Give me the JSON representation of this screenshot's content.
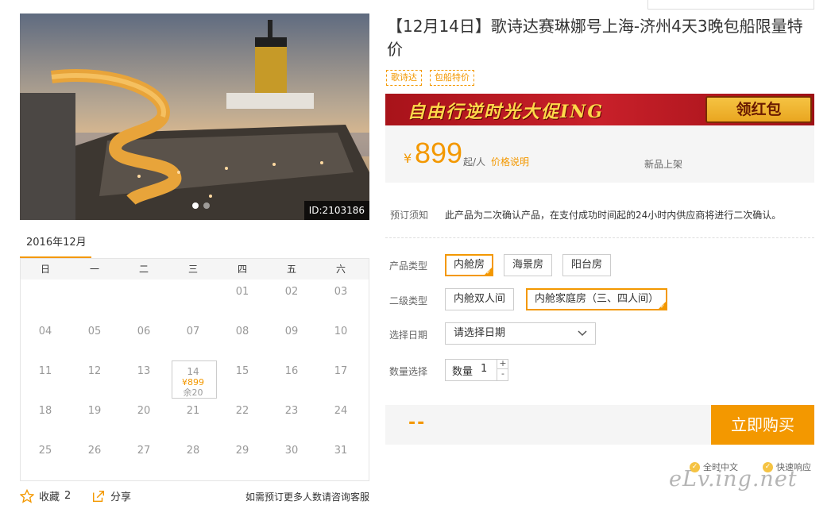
{
  "product": {
    "title": "【12月14日】歌诗达赛琳娜号上海-济州4天3晚包船限量特价",
    "tags": [
      "歌诗达",
      "包船特价"
    ],
    "photo_id": "ID:2103186"
  },
  "banner": {
    "text": "自由行逆时光大促ING",
    "button": "领红包"
  },
  "price": {
    "currency": "¥",
    "amount": "899",
    "unit": "起/人",
    "link": "价格说明",
    "badge": "新品上架"
  },
  "notice": {
    "label": "预订须知",
    "text": "此产品为二次确认产品，在支付成功时间起的24小时内供应商将进行二次确认。"
  },
  "options": {
    "product_type_label": "产品类型",
    "product_types": [
      "内舱房",
      "海景房",
      "阳台房"
    ],
    "product_type_selected": 0,
    "sub_type_label": "二级类型",
    "sub_types": [
      "内舱双人间",
      "内舱家庭房（三、四人间）"
    ],
    "sub_type_selected": 1,
    "date_label": "选择日期",
    "date_placeholder": "请选择日期",
    "qty_label": "数量选择",
    "qty_inner_label": "数量",
    "qty_value": "1",
    "plus": "+",
    "minus": "-"
  },
  "buy": {
    "total": "--",
    "button": "立即购买"
  },
  "services": [
    "全时中文",
    "快速响应"
  ],
  "calendar": {
    "month": "2016年12月",
    "weekdays": [
      "日",
      "一",
      "二",
      "三",
      "四",
      "五",
      "六"
    ],
    "rows": [
      [
        "",
        "",
        "",
        "",
        "01",
        "02",
        "03"
      ],
      [
        "04",
        "05",
        "06",
        "07",
        "08",
        "09",
        "10"
      ],
      [
        "11",
        "12",
        "13",
        "14",
        "15",
        "16",
        "17"
      ],
      [
        "18",
        "19",
        "20",
        "21",
        "22",
        "23",
        "24"
      ],
      [
        "25",
        "26",
        "27",
        "28",
        "29",
        "30",
        "31"
      ]
    ],
    "active_day": "14",
    "active_price": "¥899",
    "active_remain": "余20"
  },
  "actions": {
    "favorite": "收藏",
    "favorite_count": "2",
    "share": "分享",
    "hint": "如需预订更多人数请咨询客服"
  },
  "watermark": "eLv.ing.net",
  "colors": {
    "accent": "#f39800",
    "banner": "#b51a21"
  }
}
